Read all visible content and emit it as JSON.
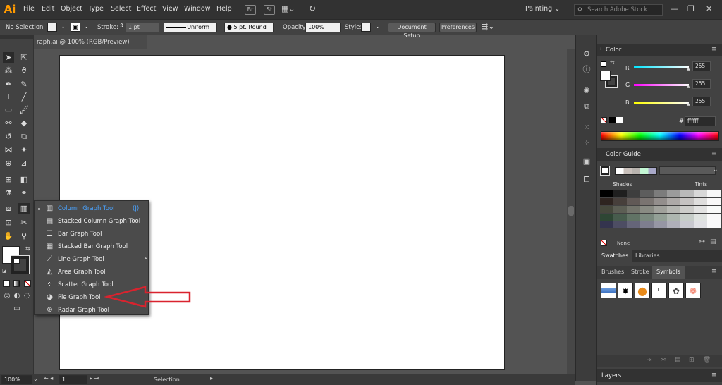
{
  "app": {
    "logo": "Ai"
  },
  "menubar": {
    "items": [
      "File",
      "Edit",
      "Object",
      "Type",
      "Select",
      "Effect",
      "View",
      "Window",
      "Help"
    ],
    "bridge_icon": "Br",
    "stock_icon": "St",
    "workspace": "Painting",
    "search_placeholder": "Search Adobe Stock"
  },
  "controlbar": {
    "selection": "No Selection",
    "stroke_label": "Stroke:",
    "stroke_weight": "1 pt",
    "profile": "Uniform",
    "brush": "5 pt. Round",
    "opacity_label": "Opacity:",
    "opacity_value": "100%",
    "style_label": "Style:",
    "document_setup": "Document Setup",
    "preferences": "Preferences"
  },
  "document": {
    "tab_title": "raph.ai @ 100% (RGB/Preview)"
  },
  "flyout": {
    "items": [
      {
        "label": "Column Graph Tool",
        "shortcut": "(J)",
        "icon": "column-graph-icon",
        "glyph": "▥"
      },
      {
        "label": "Stacked Column Graph Tool",
        "icon": "stacked-column-graph-icon",
        "glyph": "▤"
      },
      {
        "label": "Bar Graph Tool",
        "icon": "bar-graph-icon",
        "glyph": "☰"
      },
      {
        "label": "Stacked Bar Graph Tool",
        "icon": "stacked-bar-graph-icon",
        "glyph": "▦"
      },
      {
        "label": "Line Graph Tool",
        "icon": "line-graph-icon",
        "glyph": "⟋"
      },
      {
        "label": "Area Graph Tool",
        "icon": "area-graph-icon",
        "glyph": "◭"
      },
      {
        "label": "Scatter Graph Tool",
        "icon": "scatter-graph-icon",
        "glyph": "⁘"
      },
      {
        "label": "Pie Graph Tool",
        "icon": "pie-graph-icon",
        "glyph": "◕"
      },
      {
        "label": "Radar Graph Tool",
        "icon": "radar-graph-icon",
        "glyph": "⊛"
      }
    ],
    "active_index": 0,
    "highlighted_index": 7
  },
  "color_panel": {
    "title": "Color",
    "channels": [
      {
        "label": "R",
        "value": "255",
        "color": "#00e5ff"
      },
      {
        "label": "G",
        "value": "255",
        "color": "#ff00ff"
      },
      {
        "label": "B",
        "value": "255",
        "color": "#ffff00"
      }
    ],
    "hex_label": "#",
    "hex_value": "ffffff"
  },
  "color_guide": {
    "title": "Color Guide",
    "shades_label": "Shades",
    "tints_label": "Tints",
    "none_label": "None"
  },
  "swatches": {
    "tabs": [
      "Swatches",
      "Libraries"
    ]
  },
  "symbols": {
    "tabs": [
      "Brushes",
      "Stroke",
      "Symbols"
    ]
  },
  "layers": {
    "title": "Layers"
  },
  "statusbar": {
    "zoom": "100%",
    "artboard": "1",
    "tool": "Selection"
  },
  "annotation": {
    "color": "#d9232e"
  }
}
